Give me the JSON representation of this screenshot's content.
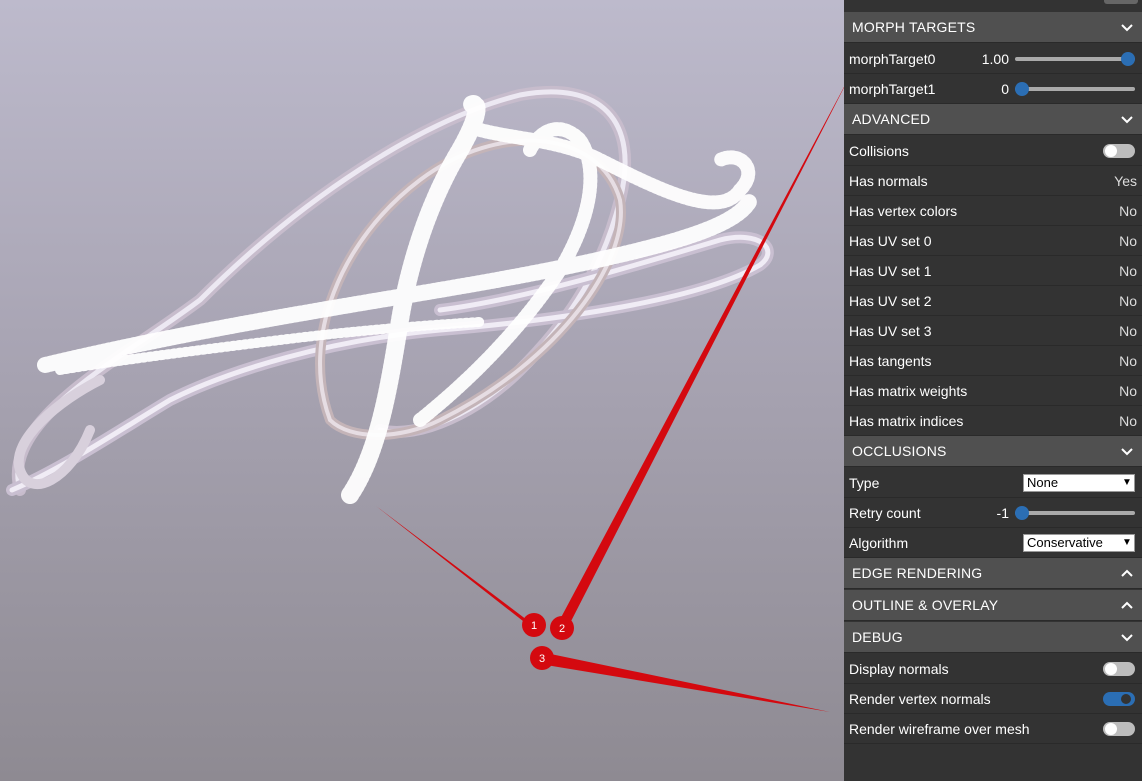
{
  "viewer": {
    "callouts": [
      "1",
      "2",
      "3"
    ]
  },
  "panel": {
    "morph": {
      "title": "MORPH TARGETS",
      "items": [
        {
          "label": "morphTarget0",
          "value": "1.00",
          "fraction": 1.0
        },
        {
          "label": "morphTarget1",
          "value": "0",
          "fraction": 0.0
        }
      ]
    },
    "advanced": {
      "title": "ADVANCED",
      "collisions": {
        "label": "Collisions",
        "on": false
      },
      "props": [
        {
          "label": "Has normals",
          "value": "Yes"
        },
        {
          "label": "Has vertex colors",
          "value": "No"
        },
        {
          "label": "Has UV set 0",
          "value": "No"
        },
        {
          "label": "Has UV set 1",
          "value": "No"
        },
        {
          "label": "Has UV set 2",
          "value": "No"
        },
        {
          "label": "Has UV set 3",
          "value": "No"
        },
        {
          "label": "Has tangents",
          "value": "No"
        },
        {
          "label": "Has matrix weights",
          "value": "No"
        },
        {
          "label": "Has matrix indices",
          "value": "No"
        }
      ]
    },
    "occlusions": {
      "title": "OCCLUSIONS",
      "type_label": "Type",
      "type_value": "None",
      "retry_label": "Retry count",
      "retry_value": "-1",
      "retry_fraction": 0.0,
      "algorithm_label": "Algorithm",
      "algorithm_value": "Conservative"
    },
    "edge": {
      "title": "EDGE RENDERING"
    },
    "outline": {
      "title": "OUTLINE & OVERLAY"
    },
    "debug": {
      "title": "DEBUG",
      "items": [
        {
          "label": "Display normals",
          "on": false
        },
        {
          "label": "Render vertex normals",
          "on": true
        },
        {
          "label": "Render wireframe over mesh",
          "on": false
        }
      ]
    }
  }
}
